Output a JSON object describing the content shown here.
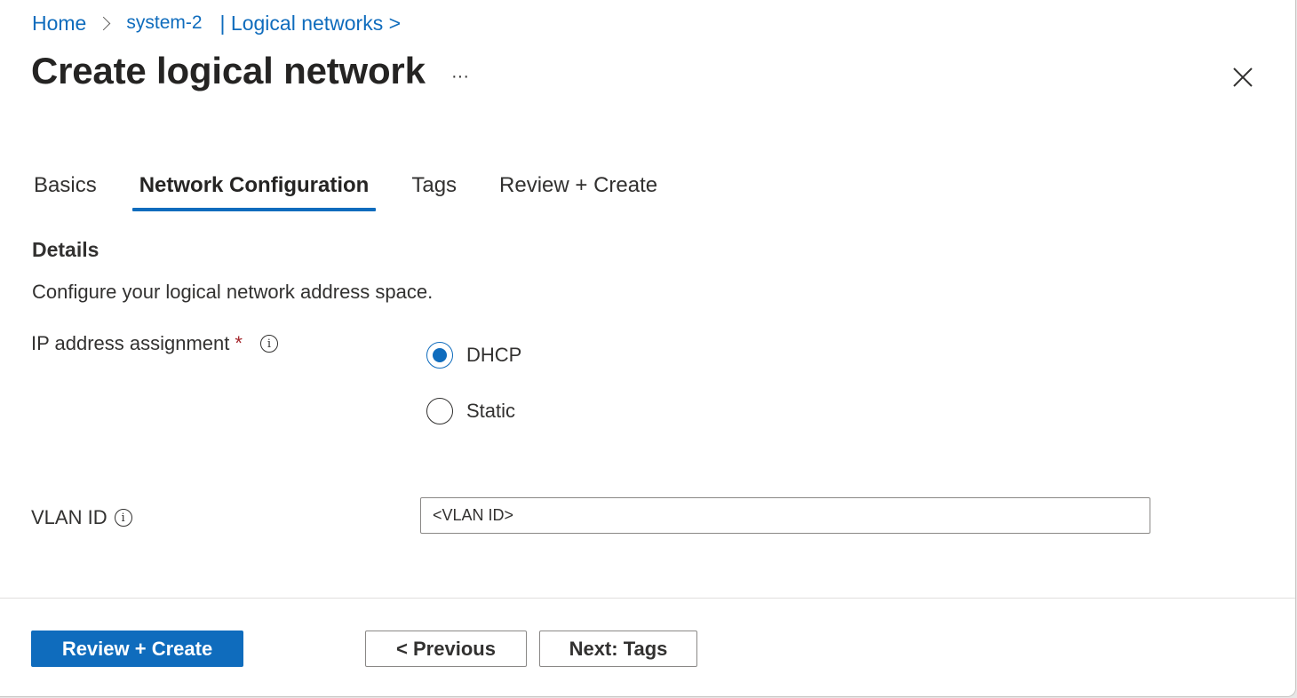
{
  "breadcrumb": {
    "home": "Home",
    "system": "system-2",
    "logical_networks": "| Logical networks >"
  },
  "header": {
    "title": "Create logical network",
    "more": "···"
  },
  "tabs": [
    {
      "label": "Basics",
      "active": false
    },
    {
      "label": "Network Configuration",
      "active": true
    },
    {
      "label": "Tags",
      "active": false
    },
    {
      "label": "Review + Create",
      "active": false
    }
  ],
  "details": {
    "title": "Details",
    "description": "Configure your logical network address space."
  },
  "ip_assignment": {
    "label": "IP address assignment",
    "required_mark": "*",
    "options": [
      {
        "label": "DHCP",
        "selected": true
      },
      {
        "label": "Static",
        "selected": false
      }
    ]
  },
  "vlan": {
    "label": "VLAN ID",
    "value": "<VLAN ID>"
  },
  "info_icon_glyph": "i",
  "footer": {
    "review_create": "Review + Create",
    "previous": "< Previous",
    "next": "Next: Tags"
  },
  "colors": {
    "accent": "#0f6cbd",
    "required": "#a4262c"
  }
}
